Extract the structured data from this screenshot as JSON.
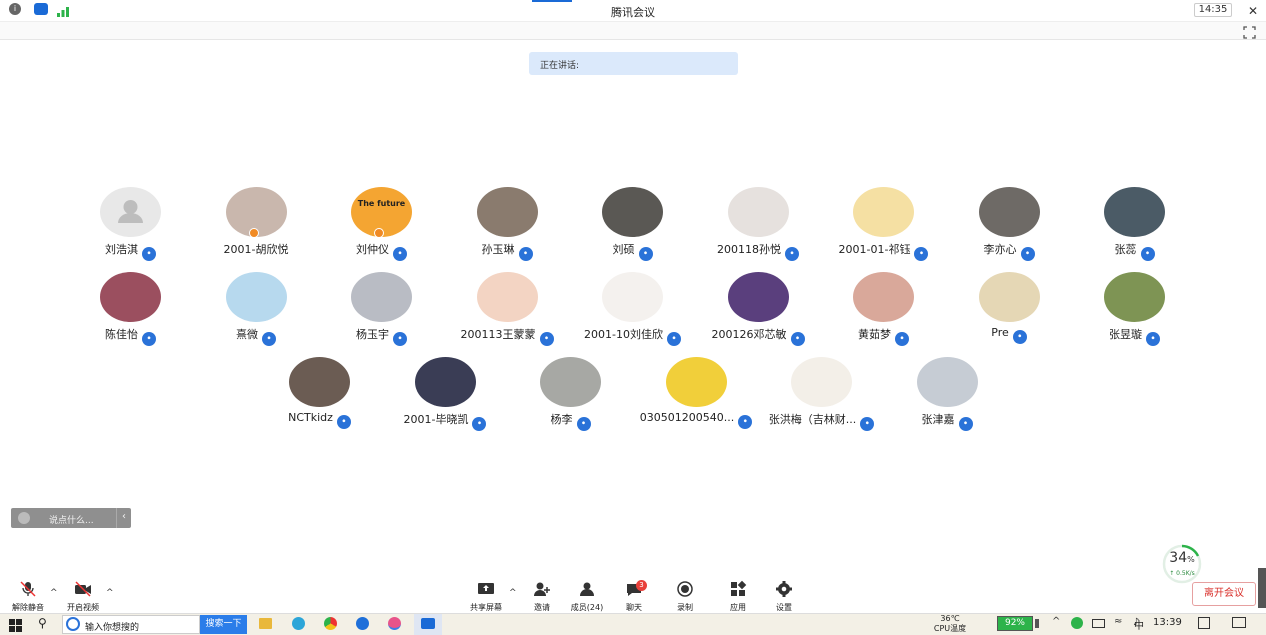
{
  "window": {
    "title": "腾讯会议",
    "minimize_icon": "minimize-icon",
    "restore_icon": "restore-icon",
    "close_icon": "close-icon"
  },
  "toolbar": {
    "clock": "14:35",
    "icons": [
      "info-icon",
      "shield-icon",
      "signal-icon"
    ],
    "fullscreen_icon": "fullscreen-icon"
  },
  "speaking": {
    "label": "正在讲话:"
  },
  "participants": [
    {
      "name": "刘浩淇",
      "color": "#e8e8e8",
      "mic": "muted"
    },
    {
      "name": "2001-胡欣悦",
      "color": "#c9b7ad",
      "badge": "host"
    },
    {
      "name": "刘仲仪",
      "color": "#f4a532",
      "mic": "muted",
      "badge": "host",
      "avatar_text": "The future"
    },
    {
      "name": "孙玉琳",
      "color": "#8a7b6e",
      "mic": "muted"
    },
    {
      "name": "刘硕",
      "color": "#5a5854",
      "mic": "muted"
    },
    {
      "name": "200118孙悦",
      "color": "#e6e1de",
      "mic": "muted"
    },
    {
      "name": "2001-01-祁钰",
      "color": "#f5e0a3",
      "mic": "muted"
    },
    {
      "name": "李亦心",
      "color": "#6e6a66",
      "mic": "muted"
    },
    {
      "name": "张蕊",
      "color": "#4b5b66",
      "mic": "muted"
    },
    {
      "name": "陈佳怡",
      "color": "#9b4f5f",
      "mic": "muted"
    },
    {
      "name": "熹微",
      "color": "#b7d9ee",
      "mic": "muted"
    },
    {
      "name": "杨玉宇",
      "color": "#b9bcc4",
      "mic": "muted"
    },
    {
      "name": "200113王蒙蒙",
      "color": "#f3d4c3",
      "mic": "muted"
    },
    {
      "name": "2001-10刘佳欣",
      "color": "#f4f1ee",
      "mic": "muted"
    },
    {
      "name": "200126邓芯敏",
      "color": "#5a3f7d",
      "mic": "muted"
    },
    {
      "name": "黄茹梦",
      "color": "#d9a89a",
      "mic": "muted"
    },
    {
      "name": "Pre",
      "color": "#e5d7b5",
      "mic": "muted"
    },
    {
      "name": "张昱璇",
      "color": "#7e9454",
      "mic": "muted"
    },
    {
      "name": "NCTkidz",
      "color": "#6b5c53",
      "mic": "muted"
    },
    {
      "name": "2001-毕晓凯",
      "color": "#3a3d55",
      "mic": "muted"
    },
    {
      "name": "杨李",
      "color": "#a7a8a4",
      "mic": "muted"
    },
    {
      "name": "030501200540...",
      "color": "#f1cf3a",
      "mic": "muted"
    },
    {
      "name": "张洪梅（吉林财...",
      "color": "#f3efe8",
      "mic": "muted"
    },
    {
      "name": "张津嘉",
      "color": "#c6ccd4",
      "mic": "muted"
    }
  ],
  "chat": {
    "placeholder": "说点什么...",
    "collapse_icon": "chevron-left-icon"
  },
  "bottombar": {
    "unmute": "解除静音",
    "video": "开启视频",
    "share": "共享屏幕",
    "invite": "邀请",
    "members": "成员(24)",
    "chat": "聊天",
    "chat_badge": "3",
    "record": "录制",
    "apps": "应用",
    "settings": "设置",
    "leave": "离开会议"
  },
  "network": {
    "percent": "34",
    "unit": "%",
    "speed": "0.5K/s"
  },
  "taskbar": {
    "search_placeholder": "输入你想搜的",
    "search_button": "搜索一下",
    "temp": "36℃",
    "temp_label": "CPU温度",
    "battery": "92%",
    "ime": "中",
    "time": "13:39"
  }
}
